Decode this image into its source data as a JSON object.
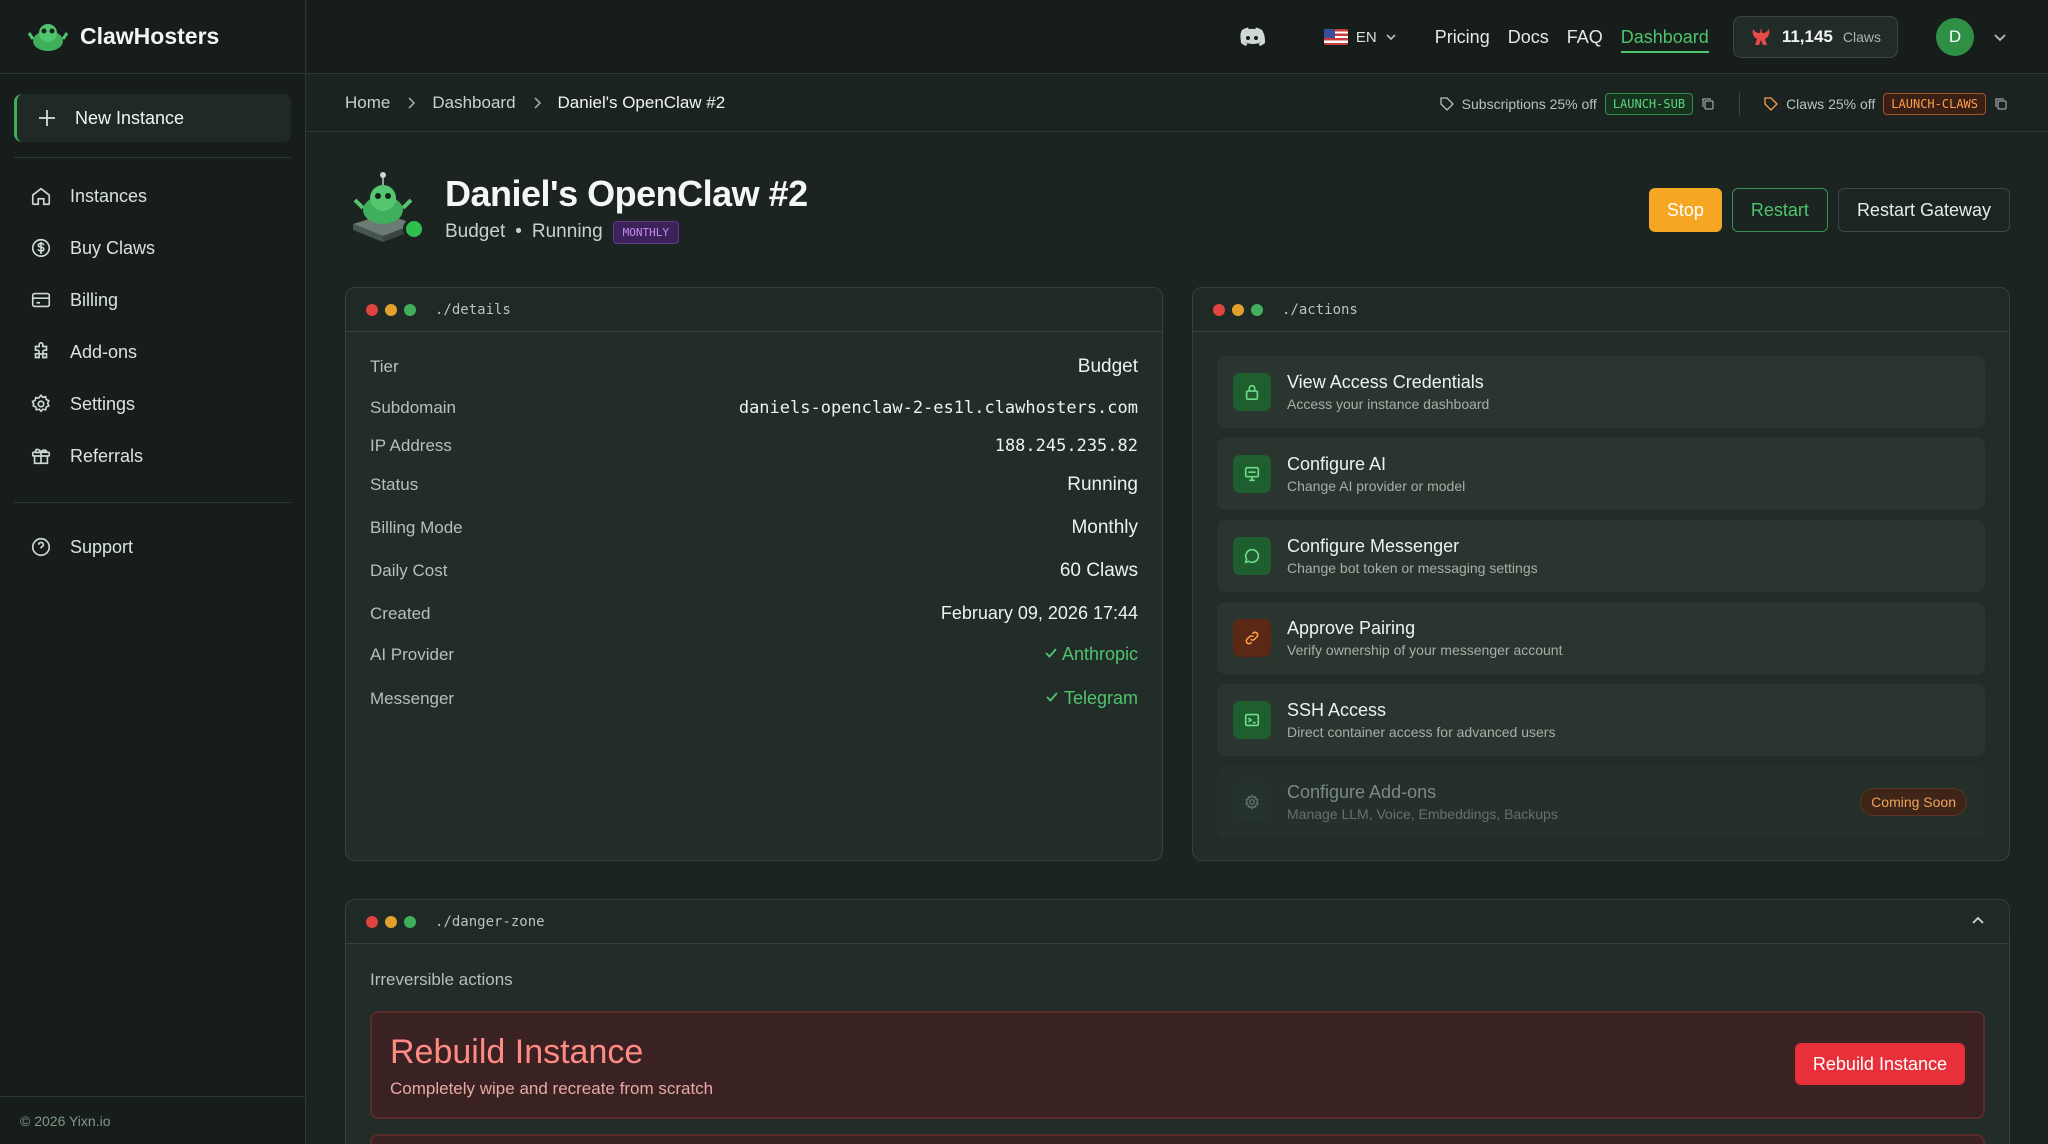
{
  "brand": {
    "name": "ClawHosters"
  },
  "sidebar": {
    "new_instance": "New Instance",
    "items": [
      {
        "label": "Instances",
        "icon": "home-icon"
      },
      {
        "label": "Buy Claws",
        "icon": "dollar-icon"
      },
      {
        "label": "Billing",
        "icon": "card-icon"
      },
      {
        "label": "Add-ons",
        "icon": "puzzle-icon"
      },
      {
        "label": "Settings",
        "icon": "gear-icon"
      },
      {
        "label": "Referrals",
        "icon": "gift-icon"
      }
    ],
    "support": "Support",
    "copyright": "© 2026 Yixn.io"
  },
  "topbar": {
    "lang": "EN",
    "links": [
      "Pricing",
      "Docs",
      "FAQ",
      "Dashboard"
    ],
    "active_link": "Dashboard",
    "claws_count": "11,145",
    "claws_unit": "Claws",
    "avatar_initial": "D"
  },
  "breadcrumb": {
    "home": "Home",
    "dashboard": "Dashboard",
    "current": "Daniel's OpenClaw #2"
  },
  "promos": {
    "sub_text": "Subscriptions 25% off",
    "sub_code": "LAUNCH-SUB",
    "claws_text": "Claws 25% off",
    "claws_code": "LAUNCH-CLAWS"
  },
  "instance": {
    "title": "Daniel's OpenClaw #2",
    "tier": "Budget",
    "status": "Running",
    "badge": "MONTHLY"
  },
  "header_actions": {
    "stop": "Stop",
    "restart": "Restart",
    "restart_gateway": "Restart Gateway"
  },
  "details": {
    "title": "./details",
    "rows": [
      {
        "label": "Tier",
        "value": "Budget"
      },
      {
        "label": "Subdomain",
        "value": "daniels-openclaw-2-es1l.clawhosters.com"
      },
      {
        "label": "IP Address",
        "value": "188.245.235.82"
      },
      {
        "label": "Status",
        "value": "Running"
      },
      {
        "label": "Billing Mode",
        "value": "Monthly"
      },
      {
        "label": "Daily Cost",
        "value": "60 Claws"
      },
      {
        "label": "Created",
        "value": "February 09, 2026 17:44"
      },
      {
        "label": "AI Provider",
        "value": "Anthropic"
      },
      {
        "label": "Messenger",
        "value": "Telegram"
      }
    ]
  },
  "actions": {
    "title": "./actions",
    "items": [
      {
        "title": "View Access Credentials",
        "sub": "Access your instance dashboard"
      },
      {
        "title": "Configure AI",
        "sub": "Change AI provider or model"
      },
      {
        "title": "Configure Messenger",
        "sub": "Change bot token or messaging settings"
      },
      {
        "title": "Approve Pairing",
        "sub": "Verify ownership of your messenger account"
      },
      {
        "title": "SSH Access",
        "sub": "Direct container access for advanced users"
      },
      {
        "title": "Configure Add-ons",
        "sub": "Manage LLM, Voice, Embeddings, Backups",
        "badge": "Coming Soon"
      }
    ]
  },
  "danger": {
    "title": "./danger-zone",
    "subtitle": "Irreversible actions",
    "rebuild_title": "Rebuild Instance",
    "rebuild_sub": "Completely wipe and recreate from scratch",
    "rebuild_button": "Rebuild Instance"
  },
  "colors": {
    "accent": "#4fc46c",
    "stop": "#f5a623",
    "danger": "#e8303a",
    "background": "#1b2420"
  }
}
